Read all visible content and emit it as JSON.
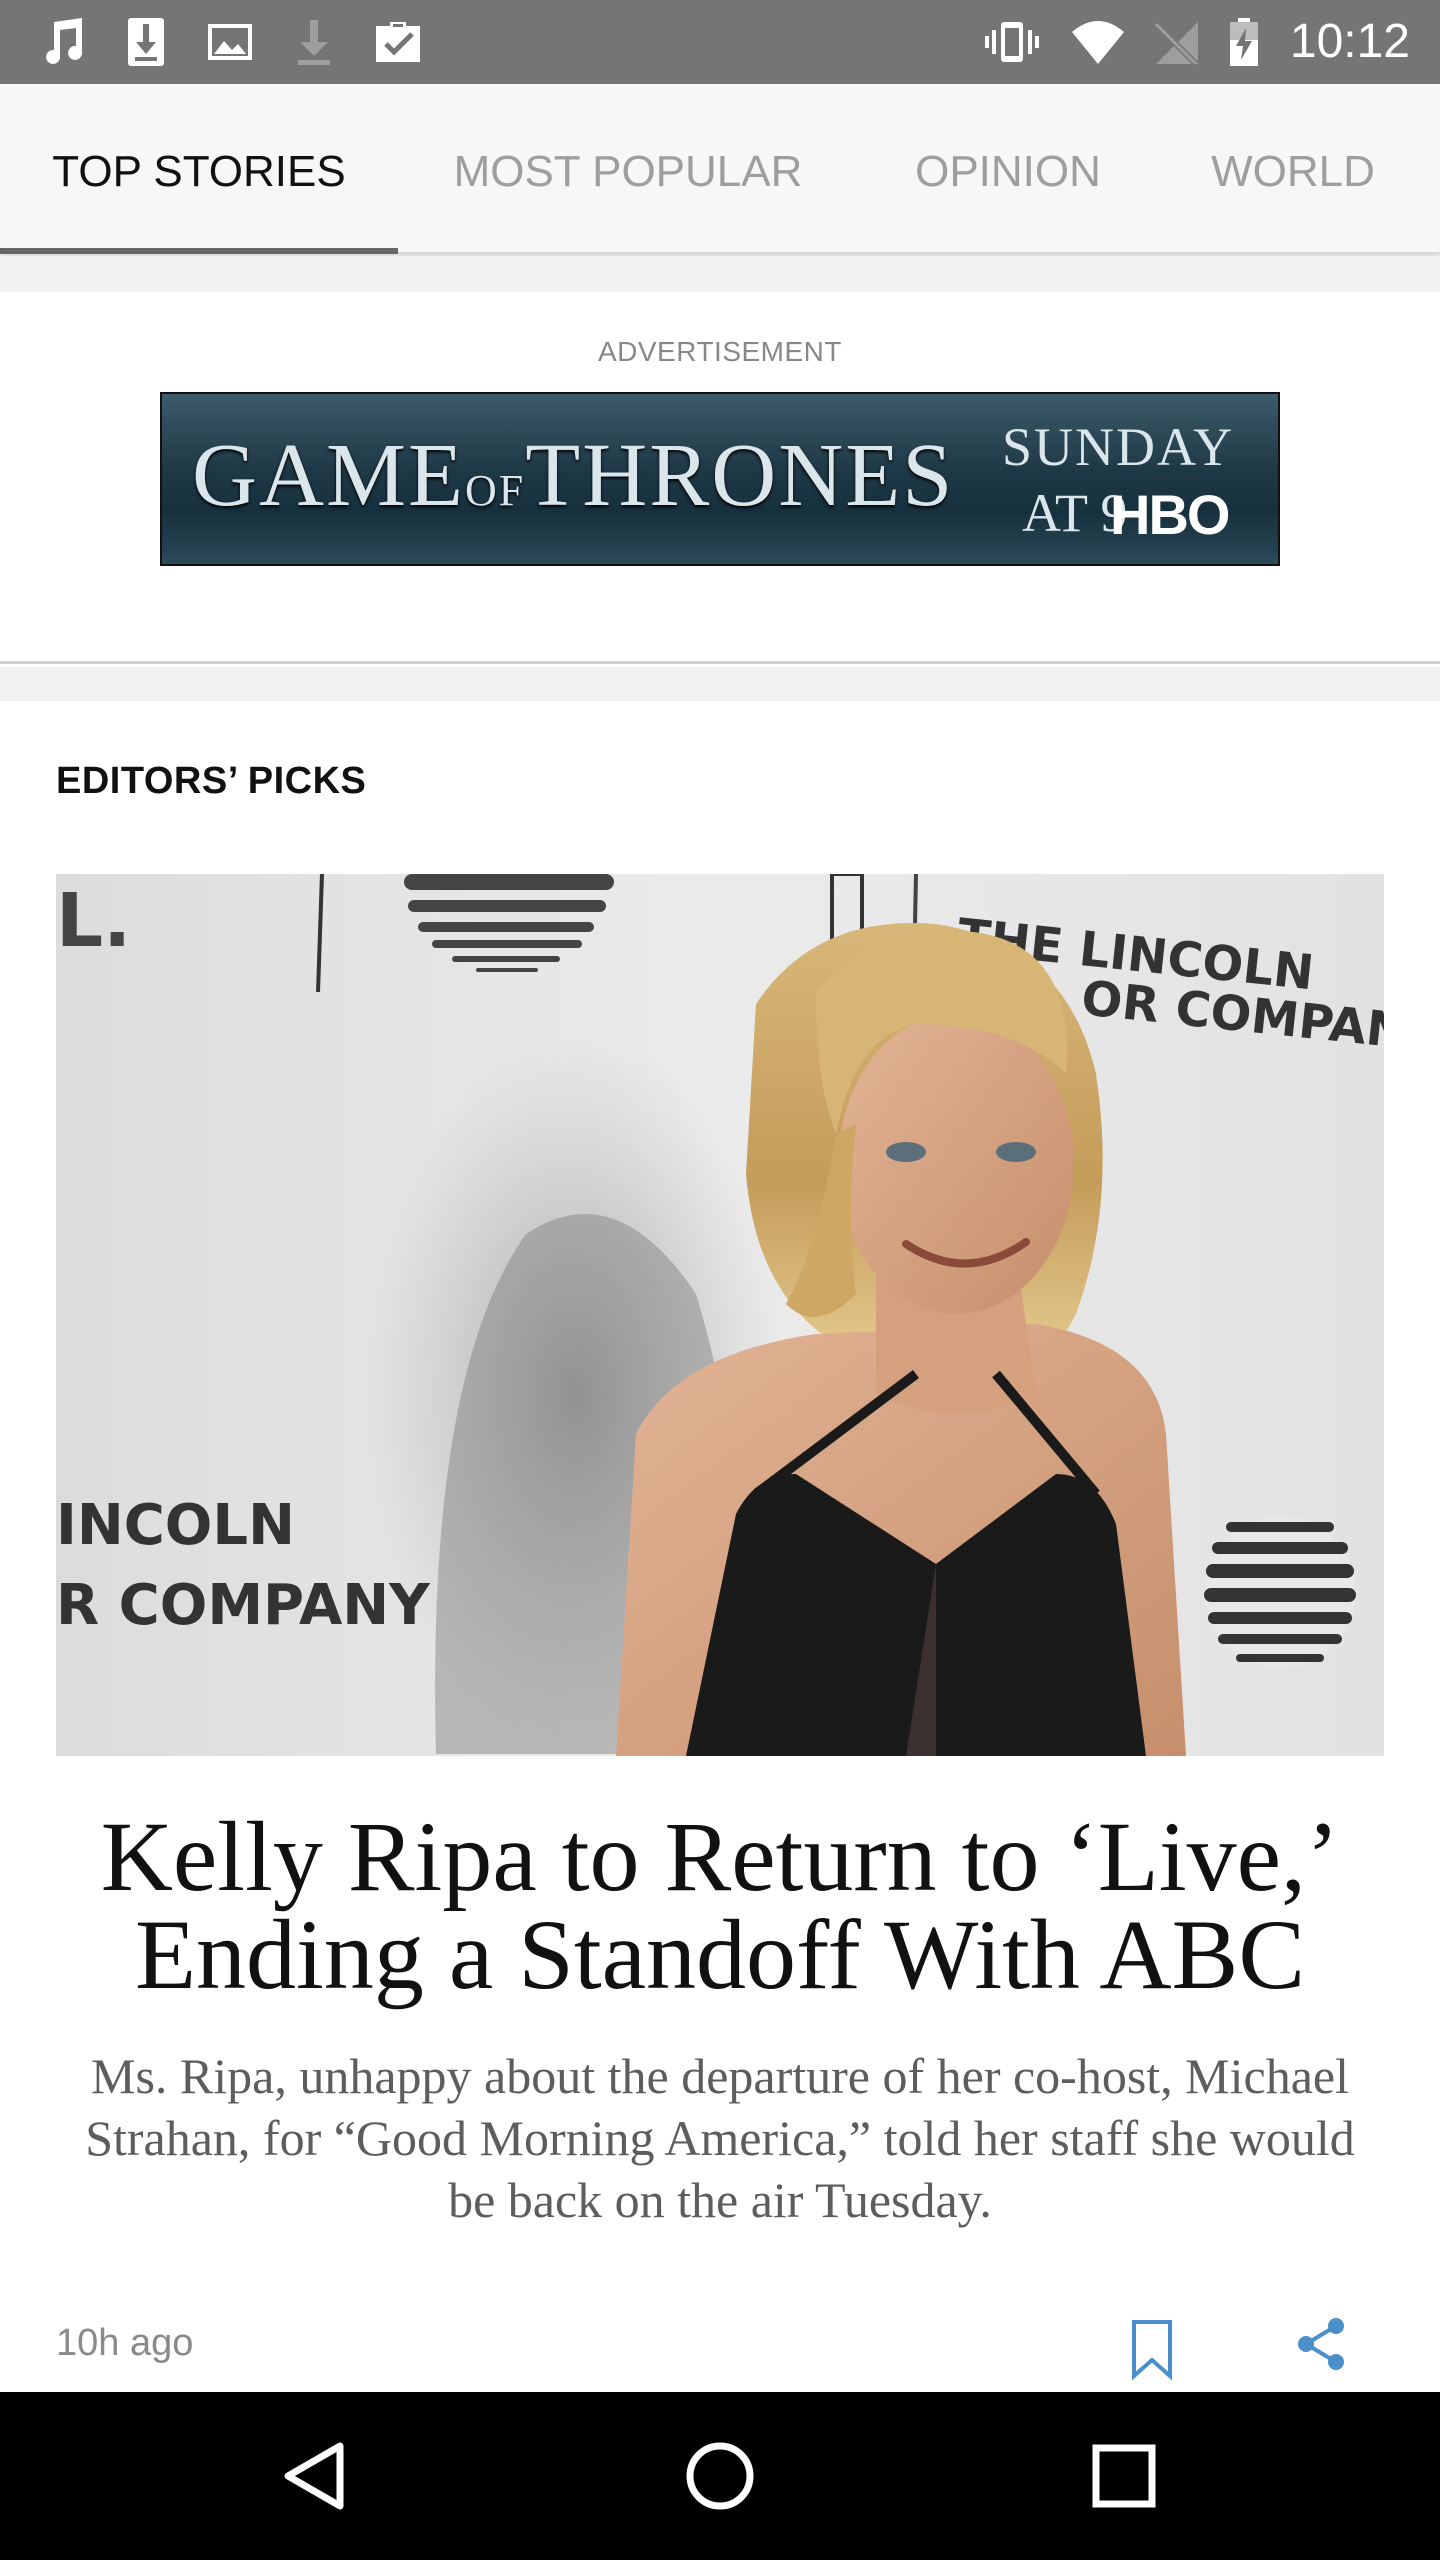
{
  "status_bar": {
    "time": "10:12",
    "left_icons": [
      "music-note-icon",
      "download-box-icon",
      "image-icon",
      "download-arrow-icon",
      "briefcase-check-icon"
    ],
    "right_icons": [
      "vibrate-icon",
      "wifi-icon",
      "no-sim-icon",
      "battery-icon"
    ]
  },
  "tabs": [
    {
      "label": "TOP STORIES",
      "active": true
    },
    {
      "label": "MOST POPULAR",
      "active": false
    },
    {
      "label": "OPINION",
      "active": false
    },
    {
      "label": "WORLD",
      "active": false
    }
  ],
  "ad": {
    "label": "ADVERTISEMENT",
    "banner_text": {
      "title_part1": "GAME",
      "title_of": "OF",
      "title_part2": "THRONES",
      "day": "SUNDAY",
      "time": "AT 9",
      "network": "HBO"
    }
  },
  "editors_picks": {
    "section_title": "EDITORS’ PICKS",
    "article": {
      "headline": "Kelly Ripa to Return to ‘Live,’ Ending a Standoff With ABC",
      "summary": "Ms. Ripa, unhappy about the departure of her co-host, Michael Strahan, for “Good Morning America,” told her staff she would be back on the air Tuesday.",
      "timestamp": "10h ago",
      "photo_backdrop_text": {
        "top_left": "L.",
        "top_right_line1": "THE LINCOLN",
        "top_right_line2": "OR COMPANY",
        "bottom_left_line1": "INCOLN",
        "bottom_left_line2": "R COMPANY"
      }
    }
  },
  "colors": {
    "status_bar": "#757575",
    "tab_bar": "#f7f7f7",
    "active_tab": "#111111",
    "inactive_tab": "#9e9e9e",
    "share_icon": "#4a8fc9"
  },
  "nav_bar": {
    "buttons": [
      "back-icon",
      "home-icon",
      "recents-icon"
    ]
  }
}
